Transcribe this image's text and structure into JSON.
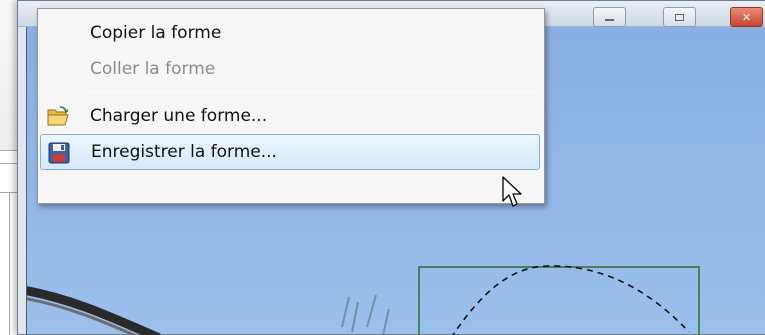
{
  "context_menu": {
    "items": [
      {
        "label": "Copier la forme",
        "enabled": true,
        "icon": null
      },
      {
        "label": "Coller la forme",
        "enabled": false,
        "icon": null
      },
      {
        "label": "Charger une forme...",
        "enabled": true,
        "icon": "open-folder-icon"
      },
      {
        "label": "Enregistrer la forme...",
        "enabled": true,
        "icon": "floppy-disk-save-icon",
        "highlighted": true
      }
    ]
  },
  "window": {
    "caption_buttons": [
      "minimize-icon",
      "maximize-icon",
      "close-icon"
    ]
  },
  "colors": {
    "canvas_background": "#8fb4e5",
    "selection_rectangle": "#2f6b2f",
    "menu_highlight_border": "#84acdd",
    "close_button": "#c74630"
  }
}
